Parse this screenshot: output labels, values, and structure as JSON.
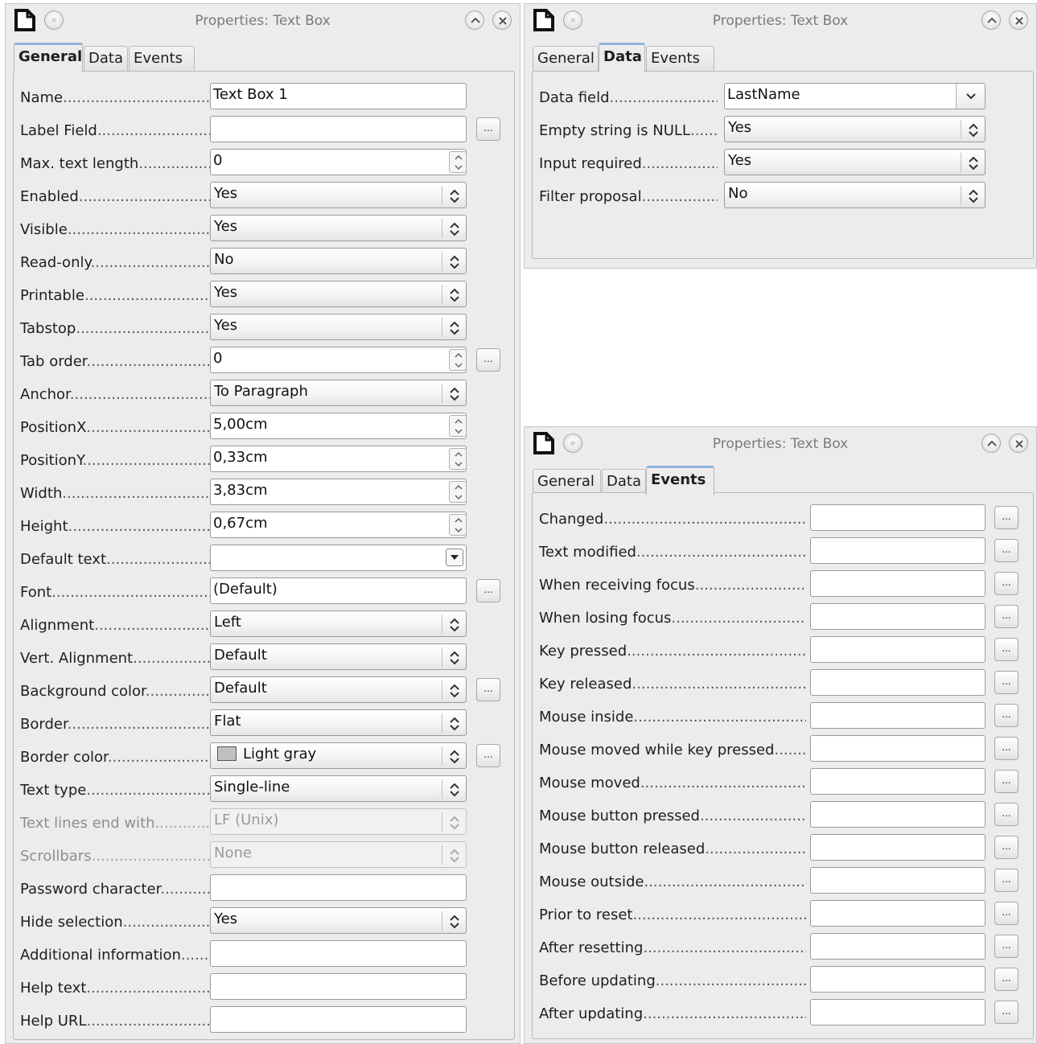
{
  "dialogs": {
    "general": {
      "title": "Properties: Text Box",
      "tabs": [
        "General",
        "Data",
        "Events"
      ],
      "active_tab": "General"
    },
    "data": {
      "title": "Properties: Text Box",
      "tabs": [
        "General",
        "Data",
        "Events"
      ],
      "active_tab": "Data"
    },
    "events": {
      "title": "Properties: Text Box",
      "tabs": [
        "General",
        "Data",
        "Events"
      ],
      "active_tab": "Events"
    }
  },
  "general": {
    "name": {
      "label": "Name",
      "value": "Text Box 1"
    },
    "label_field": {
      "label": "Label Field",
      "value": ""
    },
    "max_text_length": {
      "label": "Max. text length",
      "value": "0"
    },
    "enabled": {
      "label": "Enabled",
      "value": "Yes"
    },
    "visible": {
      "label": "Visible",
      "value": "Yes"
    },
    "read_only": {
      "label": "Read-only",
      "value": "No"
    },
    "printable": {
      "label": "Printable",
      "value": "Yes"
    },
    "tabstop": {
      "label": "Tabstop",
      "value": "Yes"
    },
    "tab_order": {
      "label": "Tab order",
      "value": "0"
    },
    "anchor": {
      "label": "Anchor",
      "value": "To Paragraph"
    },
    "position_x": {
      "label": "PositionX",
      "value": "5,00cm"
    },
    "position_y": {
      "label": "PositionY",
      "value": "0,33cm"
    },
    "width": {
      "label": "Width",
      "value": "3,83cm"
    },
    "height": {
      "label": "Height",
      "value": "0,67cm"
    },
    "default_text": {
      "label": "Default text",
      "value": ""
    },
    "font": {
      "label": "Font",
      "value": "(Default)"
    },
    "alignment": {
      "label": "Alignment",
      "value": "Left"
    },
    "vert_alignment": {
      "label": "Vert. Alignment",
      "value": "Default"
    },
    "background_color": {
      "label": "Background color",
      "value": "Default"
    },
    "border": {
      "label": "Border",
      "value": "Flat"
    },
    "border_color": {
      "label": "Border color",
      "value": "Light gray",
      "swatch": "#c0c0c0"
    },
    "text_type": {
      "label": "Text type",
      "value": "Single-line"
    },
    "text_lines_end_with": {
      "label": "Text lines end with",
      "value": "LF (Unix)"
    },
    "scrollbars": {
      "label": "Scrollbars",
      "value": "None"
    },
    "password_character": {
      "label": "Password character",
      "value": ""
    },
    "hide_selection": {
      "label": "Hide selection",
      "value": "Yes"
    },
    "additional_information": {
      "label": "Additional information",
      "value": ""
    },
    "help_text": {
      "label": "Help text",
      "value": ""
    },
    "help_url": {
      "label": "Help URL",
      "value": ""
    }
  },
  "data_tab": {
    "data_field": {
      "label": "Data field",
      "value": "LastName"
    },
    "empty_string_is_null": {
      "label": "Empty string is NULL",
      "value": "Yes"
    },
    "input_required": {
      "label": "Input required",
      "value": "Yes"
    },
    "filter_proposal": {
      "label": "Filter proposal",
      "value": "No"
    }
  },
  "events_tab": {
    "items": [
      {
        "label": "Changed",
        "value": ""
      },
      {
        "label": "Text modified",
        "value": ""
      },
      {
        "label": "When receiving focus",
        "value": ""
      },
      {
        "label": "When losing focus",
        "value": ""
      },
      {
        "label": "Key pressed",
        "value": ""
      },
      {
        "label": "Key released",
        "value": ""
      },
      {
        "label": "Mouse inside",
        "value": ""
      },
      {
        "label": "Mouse moved while key pressed",
        "value": ""
      },
      {
        "label": "Mouse moved",
        "value": ""
      },
      {
        "label": "Mouse button pressed",
        "value": ""
      },
      {
        "label": "Mouse button released",
        "value": ""
      },
      {
        "label": "Mouse outside",
        "value": ""
      },
      {
        "label": "Prior to reset",
        "value": ""
      },
      {
        "label": "After resetting",
        "value": ""
      },
      {
        "label": "Before updating",
        "value": ""
      },
      {
        "label": "After updating",
        "value": ""
      }
    ],
    "browse_button": "..."
  },
  "browse_button": "...",
  "icons": {
    "app": "document-icon",
    "menu": "window-menu-icon",
    "rollup": "chevron-up-icon",
    "close": "close-icon"
  }
}
